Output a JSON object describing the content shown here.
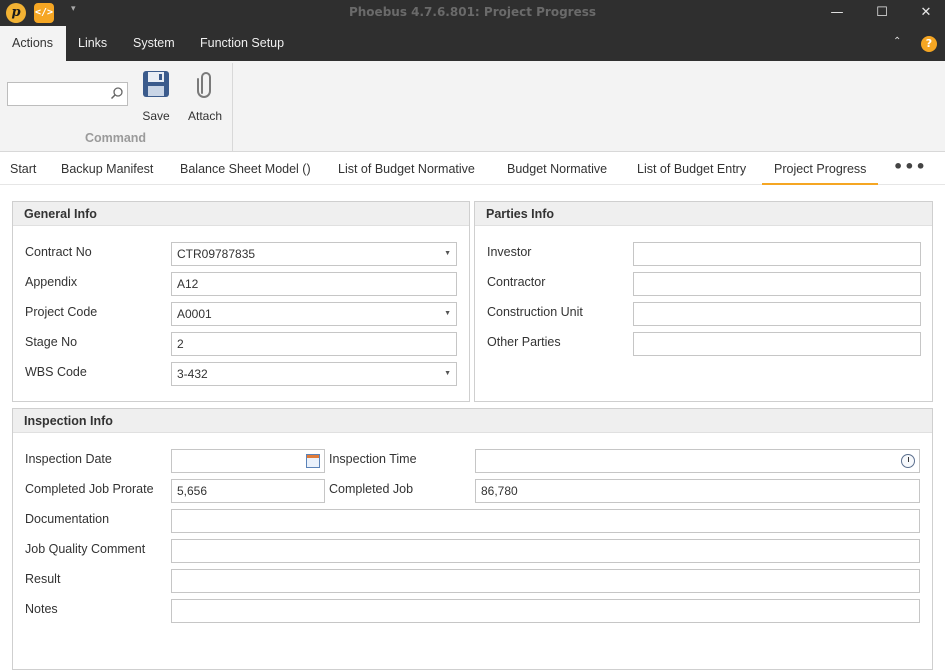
{
  "window": {
    "title": "Phoebus 4.7.6.801: Project Progress",
    "logo_letter": "p",
    "code_glyph": "</>",
    "qa_arrow": "▾",
    "minimize": "—",
    "maximize": "☐",
    "close": "✕"
  },
  "menu": {
    "items": [
      "Actions",
      "Links",
      "System",
      "Function Setup"
    ],
    "caret": "⌃",
    "help": "?"
  },
  "ribbon": {
    "search": {
      "value": "",
      "placeholder": ""
    },
    "save_label": "Save",
    "attach_label": "Attach",
    "group_label": "Command"
  },
  "tabs": {
    "items": [
      "Start",
      "Backup Manifest",
      "Balance Sheet Model ()",
      "List of Budget Normative",
      "Budget Normative",
      "List of Budget Entry",
      "Project Progress"
    ],
    "active": "Project Progress",
    "more": "•••"
  },
  "general_info": {
    "title": "General Info",
    "contract_no": {
      "label": "Contract No",
      "value": "CTR09787835"
    },
    "appendix": {
      "label": "Appendix",
      "value": "A12"
    },
    "project_code": {
      "label": "Project Code",
      "value": "A0001"
    },
    "stage_no": {
      "label": "Stage No",
      "value": "2"
    },
    "wbs_code": {
      "label": "WBS Code",
      "value": "3-432"
    }
  },
  "parties_info": {
    "title": "Parties Info",
    "investor": {
      "label": "Investor",
      "value": ""
    },
    "contractor": {
      "label": "Contractor",
      "value": ""
    },
    "construction_unit": {
      "label": "Construction Unit",
      "value": ""
    },
    "other_parties": {
      "label": "Other Parties",
      "value": ""
    }
  },
  "inspection_info": {
    "title": "Inspection Info",
    "inspection_date": {
      "label": "Inspection Date",
      "value": ""
    },
    "inspection_time": {
      "label": "Inspection Time",
      "value": ""
    },
    "completed_job_prorate": {
      "label": "Completed Job Prorate",
      "value": "5,656"
    },
    "completed_job": {
      "label": "Completed Job",
      "value": "86,780"
    },
    "documentation": {
      "label": "Documentation",
      "value": ""
    },
    "job_quality_comment": {
      "label": "Job Quality Comment",
      "value": ""
    },
    "result": {
      "label": "Result",
      "value": ""
    },
    "notes": {
      "label": "Notes",
      "value": ""
    }
  },
  "colors": {
    "accent": "#f5a623",
    "titlebar": "#2f2f2f",
    "ribbon": "#f3f3f3"
  }
}
